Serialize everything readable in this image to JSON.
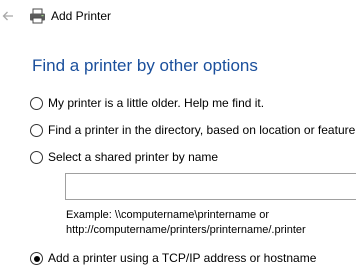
{
  "window": {
    "title": "Add Printer",
    "back_icon": "back-arrow-icon",
    "app_icon": "printer-icon"
  },
  "heading": "Find a printer by other options",
  "options": [
    {
      "label": "My printer is a little older. Help me find it.",
      "checked": false
    },
    {
      "label": "Find a printer in the directory, based on location or feature",
      "checked": false
    },
    {
      "label": "Select a shared printer by name",
      "checked": false
    },
    {
      "label": "Add a printer using a TCP/IP address or hostname",
      "checked": true
    }
  ],
  "shared_printer_input": {
    "value": "",
    "placeholder": ""
  },
  "example": {
    "line1": "Example: \\\\computername\\printername or",
    "line2": "http://computername/printers/printername/.printer"
  },
  "colors": {
    "heading": "#1a4f9c",
    "background": "#ffffff"
  }
}
